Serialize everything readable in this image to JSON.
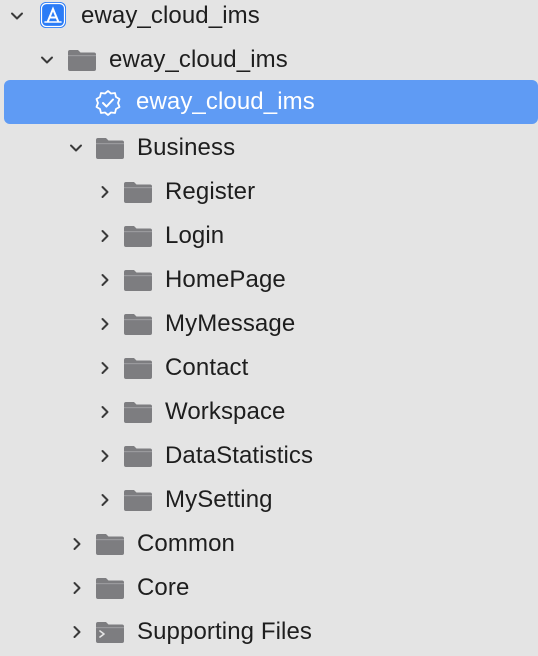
{
  "tree": {
    "project": {
      "label": "eway_cloud_ims",
      "icon": "app-project-icon",
      "expanded": true
    },
    "group_root": {
      "label": "eway_cloud_ims",
      "icon": "folder-icon",
      "expanded": true
    },
    "target": {
      "label": "eway_cloud_ims",
      "icon": "target-badge-icon",
      "selected": true
    },
    "business": {
      "label": "Business",
      "icon": "folder-icon",
      "expanded": true
    },
    "business_children": [
      {
        "label": "Register",
        "icon": "folder-icon",
        "expanded": false
      },
      {
        "label": "Login",
        "icon": "folder-icon",
        "expanded": false
      },
      {
        "label": "HomePage",
        "icon": "folder-icon",
        "expanded": false
      },
      {
        "label": "MyMessage",
        "icon": "folder-icon",
        "expanded": false
      },
      {
        "label": "Contact",
        "icon": "folder-icon",
        "expanded": false
      },
      {
        "label": "Workspace",
        "icon": "folder-icon",
        "expanded": false
      },
      {
        "label": "DataStatistics",
        "icon": "folder-icon",
        "expanded": false
      },
      {
        "label": "MySetting",
        "icon": "folder-icon",
        "expanded": false
      }
    ],
    "common": {
      "label": "Common",
      "icon": "folder-icon",
      "expanded": false
    },
    "core": {
      "label": "Core",
      "icon": "folder-icon",
      "expanded": false
    },
    "supporting": {
      "label": "Supporting Files",
      "icon": "folder-special-icon",
      "expanded": false
    }
  },
  "colors": {
    "background": "#e4e4e4",
    "selection": "#5f9bf4",
    "folder": "#7d7d80",
    "chevron": "#3a3a3a",
    "app_icon": "#2b7cf6"
  }
}
